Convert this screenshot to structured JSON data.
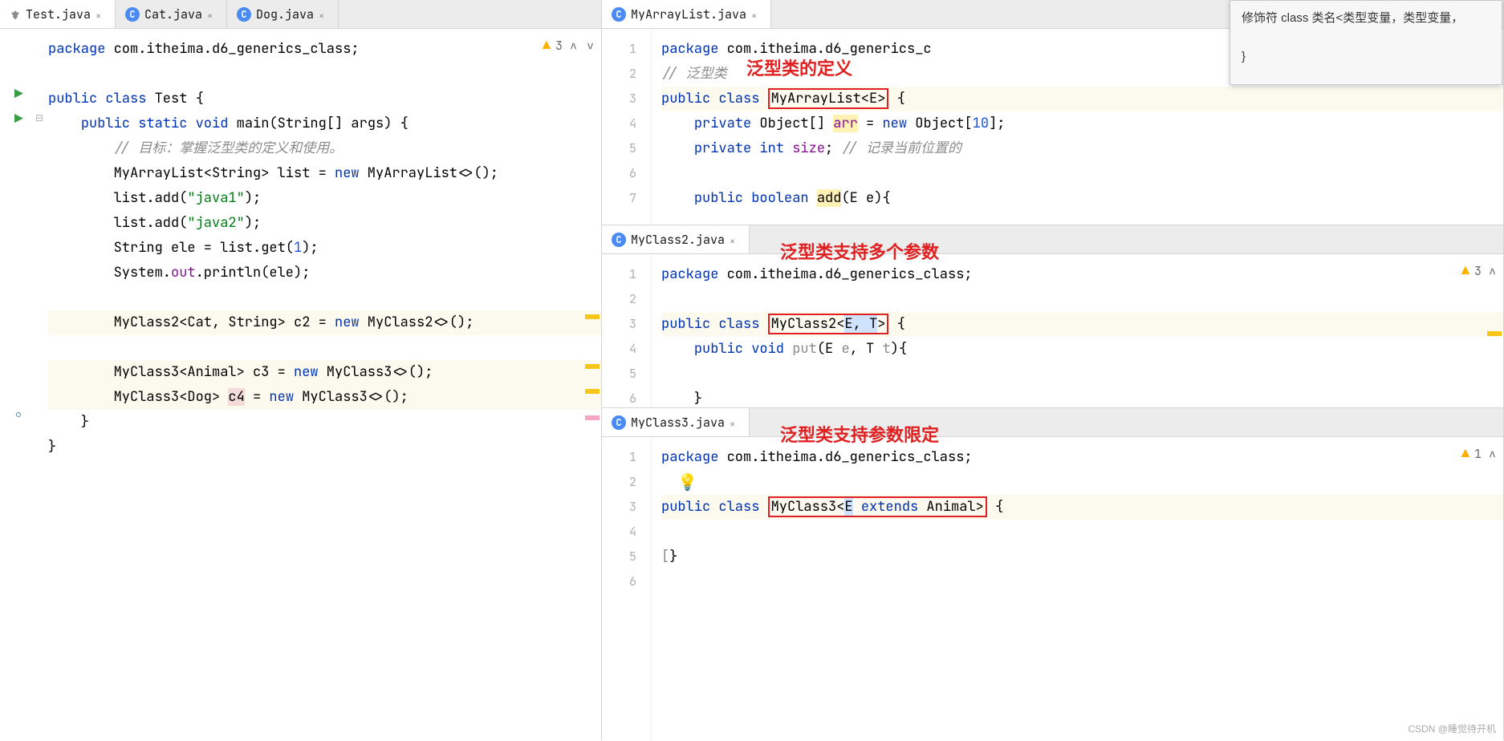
{
  "left": {
    "tabs": [
      {
        "label": "Test.java",
        "active": true
      },
      {
        "label": "Cat.java",
        "active": false
      },
      {
        "label": "Dog.java",
        "active": false
      }
    ],
    "warn_count": "3",
    "lines": [
      "package com.itheima.d6_generics_class;",
      "",
      "public class Test {",
      "    public static void main(String[] args) {",
      "        // 目标：掌握泛型类的定义和使用。",
      "        MyArrayList<String> list = new MyArrayList<>();",
      "        list.add(\"java1\");",
      "        list.add(\"java2\");",
      "        String ele = list.get(1);",
      "        System.out.println(ele);",
      "",
      "        MyClass2<Cat, String> c2 = new MyClass2<>();",
      "",
      "        MyClass3<Animal> c3 = new MyClass3<>();",
      "        MyClass3<Dog> c4 = new MyClass3<>();",
      "    }",
      "}"
    ]
  },
  "right_top": {
    "tab": "MyArrayList.java",
    "label": "泛型类的定义",
    "gutter": [
      "1",
      "2",
      "3",
      "4",
      "5",
      "6",
      "7",
      "⋮"
    ],
    "lines": {
      "pkg": "package com.itheima.d6_generics_c",
      "cmt": "// 泛型类",
      "cls_pre": "public class ",
      "cls_box": "MyArrayList<E>",
      "cls_post": " {",
      "l4": "    private Object[] arr = new Object[10];",
      "l5": "    private int size; // 记录当前位置的",
      "l7": "    public boolean add(E e){"
    }
  },
  "right_mid": {
    "tab": "MyClass2.java",
    "label": "泛型类支持多个参数",
    "warn_count": "3",
    "gutter": [
      "1",
      "2",
      "3",
      "4",
      "5",
      "6"
    ],
    "lines": {
      "pkg": "package com.itheima.d6_generics_class;",
      "cls_pre": "public class ",
      "cls_name": "MyClass2<",
      "cls_params": "E, T",
      "cls_close": ">",
      "cls_post": " {",
      "l4": "    public void put(E e, T t){",
      "l6": "    }"
    }
  },
  "right_bot": {
    "tab": "MyClass3.java",
    "label": "泛型类支持参数限定",
    "warn_count": "1",
    "gutter": [
      "1",
      "2",
      "3",
      "4",
      "5",
      "6"
    ],
    "lines": {
      "pkg": "package com.itheima.d6_generics_class;",
      "cls_pre": "public class ",
      "cls_name": "MyClass3<",
      "cls_e": "E",
      "cls_ext": " extends Animal",
      "cls_close": ">",
      "cls_post": " {",
      "l5": "}"
    }
  },
  "tooltip": {
    "line1": "修饰符 class 类名<类型变量，类型变量，",
    "line2": "}"
  },
  "watermark": "CSDN @睡觉待开机"
}
